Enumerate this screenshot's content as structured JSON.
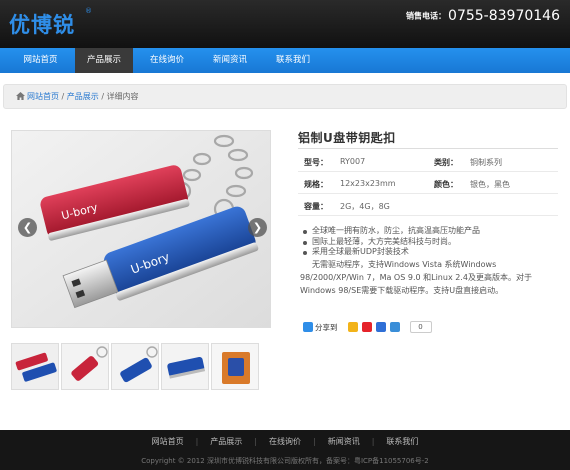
{
  "header": {
    "logo": "优博锐",
    "logo_reg": "®",
    "hotline_label": "销售电话：",
    "hotline_number": "0755-83970146"
  },
  "nav": {
    "items": [
      {
        "label": "网站首页"
      },
      {
        "label": "产品展示"
      },
      {
        "label": "在线询价"
      },
      {
        "label": "新闻资讯"
      },
      {
        "label": "联系我们"
      }
    ],
    "active": "产品展示"
  },
  "breadcrumb": {
    "home": "网站首页",
    "sep": " / ",
    "category": "产品展示",
    "current": "详细内容"
  },
  "product": {
    "title": "铝制U盘带钥匙扣",
    "specs": {
      "model_label": "型号：",
      "model": "RY007",
      "category_label": "类别：",
      "category": "铜制系列",
      "size_label": "规格：",
      "size": "12x23x23mm",
      "color_label": "颜色：",
      "color": "银色，黑色",
      "capacity_label": "容量：",
      "capacity": "2G，4G，8G"
    },
    "features": [
      "全球唯一拥有防水，防尘，抗高温高压功能产品",
      "国际上最轻薄，大方完美结科技与时尚。",
      "采用全球最新UDP封装技术"
    ],
    "description": "无需驱动程序，支持Windows Vista 系统Windows 98/2000/XP/Win 7，Ma OS 9.0 和Linux 2.4及更高版本。对于Windows 98/SE需要下载驱动程序。支持U盘直接启动。",
    "share_label": "分享到",
    "share_count": "0",
    "share_icons": [
      "qzone-icon",
      "weibo-icon",
      "baidu-icon",
      "renren-icon"
    ],
    "arrow_left": "❮",
    "arrow_right": "❯",
    "thumbnail_count": 5
  },
  "footer": {
    "nav": [
      "网站首页",
      "产品展示",
      "在线询价",
      "新闻资讯",
      "联系我们"
    ],
    "copyright": "Copyright © 2012 深圳市优博锐科技有限公司版权所有，备案号：粤ICP备11055706号-2"
  },
  "colors": {
    "brand_blue": "#2f8ee8",
    "nav_blue": "#1f86e0",
    "nav_active": "#3a3a3a",
    "header_bg": "#1a1a1a",
    "usb_red": "#c8243b",
    "usb_blue": "#1f4fb0"
  }
}
